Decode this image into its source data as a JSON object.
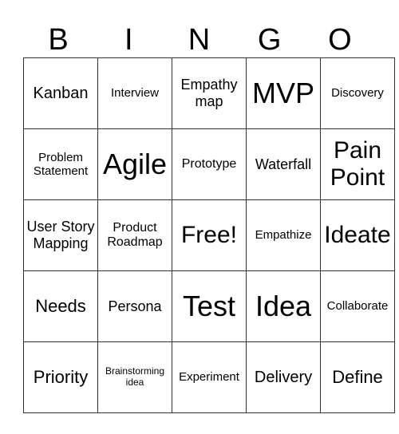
{
  "header": [
    "B",
    "I",
    "N",
    "G",
    "O"
  ],
  "rows": [
    [
      {
        "text": "Kanban",
        "size": "s-m"
      },
      {
        "text": "Interview",
        "size": "s-xs"
      },
      {
        "text": "Empathy map",
        "size": "s-sm"
      },
      {
        "text": "MVP",
        "size": "s-xl"
      },
      {
        "text": "Discovery",
        "size": "s-xs"
      }
    ],
    [
      {
        "text": "Problem Statement",
        "size": "s-xs"
      },
      {
        "text": "Agile",
        "size": "s-xl"
      },
      {
        "text": "Prototype",
        "size": "s-s"
      },
      {
        "text": "Waterfall",
        "size": "s-sm"
      },
      {
        "text": "Pain Point",
        "size": "s-l"
      }
    ],
    [
      {
        "text": "User Story Mapping",
        "size": "s-sm"
      },
      {
        "text": "Product Roadmap",
        "size": "s-s"
      },
      {
        "text": "Free!",
        "size": "s-l"
      },
      {
        "text": "Empathize",
        "size": "s-xs"
      },
      {
        "text": "Ideate",
        "size": "s-l"
      }
    ],
    [
      {
        "text": "Needs",
        "size": "s-ml"
      },
      {
        "text": "Persona",
        "size": "s-sm"
      },
      {
        "text": "Test",
        "size": "s-xl"
      },
      {
        "text": "Idea",
        "size": "s-xl"
      },
      {
        "text": "Collaborate",
        "size": "s-xs"
      }
    ],
    [
      {
        "text": "Priority",
        "size": "s-ml"
      },
      {
        "text": "Brainstorming idea",
        "size": "s-xxs"
      },
      {
        "text": "Experiment",
        "size": "s-xs"
      },
      {
        "text": "Delivery",
        "size": "s-m"
      },
      {
        "text": "Define",
        "size": "s-ml"
      }
    ]
  ]
}
